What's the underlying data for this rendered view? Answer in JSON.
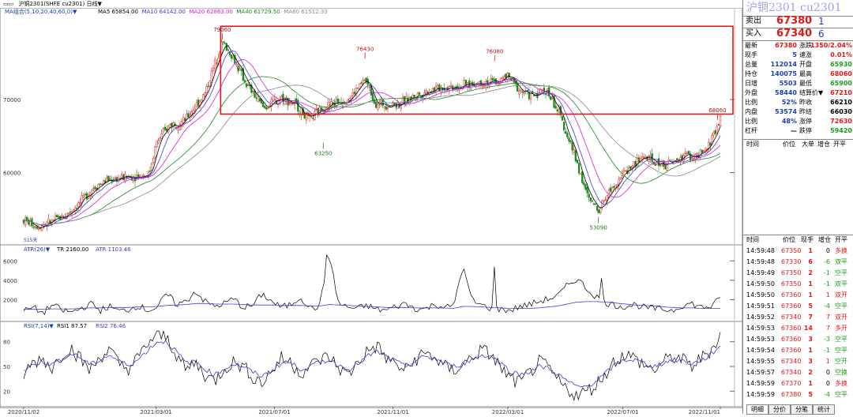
{
  "window": {
    "title": "沪铜2301(SHFE cu2301) 日线▼"
  },
  "main_legend": {
    "indicator": "MA组合(5,10,20,40,60,0)▼",
    "items": [
      {
        "text": "MA5 65854.00",
        "color": "#000000"
      },
      {
        "text": "MA10 64142.00",
        "color": "#3b3bd8"
      },
      {
        "text": "MA20 62863.00",
        "color": "#d81bd8"
      },
      {
        "text": "MA40 61729.50",
        "color": "#1a8a1a"
      },
      {
        "text": "MA60 61512.33",
        "color": "#888888"
      }
    ]
  },
  "atr_legend": {
    "indicator": "ATR(26)▼",
    "items": [
      {
        "text": "TR 2160.00",
        "color": "#000000"
      },
      {
        "text": "ATR 1103.46",
        "color": "#3b3bd8"
      }
    ]
  },
  "rsi_legend": {
    "indicator": "RSI(7,14)▼",
    "items": [
      {
        "text": "RSI1 87.57",
        "color": "#000000"
      },
      {
        "text": "RSI2 76.46",
        "color": "#3b3bd8"
      }
    ]
  },
  "left_marker": "515天",
  "colors": {
    "up": "#e01818",
    "down": "#1a8a1a",
    "box": "#e01818",
    "ma5": "#000000",
    "ma10": "#3b3bd8",
    "ma20": "#d81bd8",
    "ma40": "#1a8a1a",
    "ma60": "#888888",
    "title": "#9f9ff0"
  },
  "chart_data": [
    {
      "type": "candlestick",
      "title": "沪铜2301(SHFE cu2301) 日线",
      "x_tick_labels": [
        "2020/11/02",
        "2021/03/01",
        "2021/07/01",
        "2021/11/01",
        "2022/03/01",
        "2022/07/01",
        "2022/11/01"
      ],
      "x_tick_positions": [
        0,
        0.19,
        0.36,
        0.53,
        0.695,
        0.86,
        1.0
      ],
      "y_tick_labels": [
        "60000",
        "70000"
      ],
      "ylim": [
        51000,
        81000
      ],
      "series_points": [
        [
          0,
          53500
        ],
        [
          0.02,
          52700
        ],
        [
          0.04,
          53300
        ],
        [
          0.06,
          54200
        ],
        [
          0.08,
          55800
        ],
        [
          0.1,
          58000
        ],
        [
          0.12,
          59000
        ],
        [
          0.14,
          59300
        ],
        [
          0.165,
          59600
        ],
        [
          0.18,
          59800
        ],
        [
          0.19,
          64000
        ],
        [
          0.21,
          66600
        ],
        [
          0.23,
          67000
        ],
        [
          0.26,
          70800
        ],
        [
          0.285,
          77900
        ],
        [
          0.3,
          75800
        ],
        [
          0.32,
          72000
        ],
        [
          0.345,
          68800
        ],
        [
          0.37,
          70300
        ],
        [
          0.39,
          69300
        ],
        [
          0.41,
          67100
        ],
        [
          0.43,
          69000
        ],
        [
          0.45,
          69600
        ],
        [
          0.47,
          70400
        ],
        [
          0.49,
          72800
        ],
        [
          0.505,
          69500
        ],
        [
          0.52,
          69300
        ],
        [
          0.54,
          69400
        ],
        [
          0.56,
          70400
        ],
        [
          0.58,
          71200
        ],
        [
          0.6,
          71600
        ],
        [
          0.62,
          71800
        ],
        [
          0.64,
          72000
        ],
        [
          0.66,
          72400
        ],
        [
          0.68,
          72400
        ],
        [
          0.695,
          73200
        ],
        [
          0.71,
          71400
        ],
        [
          0.73,
          70400
        ],
        [
          0.75,
          71400
        ],
        [
          0.77,
          67800
        ],
        [
          0.79,
          62600
        ],
        [
          0.81,
          56500
        ],
        [
          0.825,
          55000
        ],
        [
          0.84,
          57400
        ],
        [
          0.86,
          59900
        ],
        [
          0.875,
          61000
        ],
        [
          0.89,
          62300
        ],
        [
          0.905,
          61300
        ],
        [
          0.92,
          61200
        ],
        [
          0.935,
          61400
        ],
        [
          0.95,
          62600
        ],
        [
          0.965,
          62000
        ],
        [
          0.98,
          63000
        ],
        [
          1.0,
          67380
        ]
      ],
      "price_annotations": [
        {
          "text": "79060",
          "x_frac": 0.285,
          "value": 79060,
          "pos": "above"
        },
        {
          "text": "76430",
          "x_frac": 0.49,
          "value": 76430,
          "pos": "above"
        },
        {
          "text": "76080",
          "x_frac": 0.676,
          "value": 76080,
          "pos": "above"
        },
        {
          "text": "63250",
          "x_frac": 0.43,
          "value": 63250,
          "pos": "below"
        },
        {
          "text": "53090",
          "x_frac": 0.825,
          "value": 53090,
          "pos": "below"
        },
        {
          "text": "68060",
          "x_frac": 0.996,
          "value": 68060,
          "pos": "above"
        }
      ],
      "box": {
        "x_range": [
          0.285,
          1.0
        ],
        "y_range": [
          68000,
          80000
        ]
      }
    },
    {
      "type": "line",
      "title": "ATR(26)",
      "y_tick_labels": [
        "2000",
        "4000",
        "6000"
      ],
      "ylim": [
        0,
        7000
      ],
      "series": [
        {
          "name": "TR",
          "values": [
            800,
            1200,
            600,
            1500,
            900,
            700,
            1100,
            1600,
            900,
            1300,
            800,
            1000,
            1400,
            900,
            1200,
            2600,
            1500,
            1800,
            2900,
            1800,
            1300,
            1600,
            2100,
            1200,
            1400,
            2600,
            1800,
            1200,
            1500,
            2300,
            1100,
            1300,
            6600,
            1600,
            1200,
            1100,
            1400,
            1000,
            900,
            1300,
            1600,
            1100,
            1000,
            1500,
            1300,
            1200,
            5400,
            1900,
            1400,
            1100,
            1000,
            900,
            1300,
            1500,
            1800,
            2100,
            2400,
            3500,
            4200,
            3100,
            2300,
            1700,
            1400,
            1300,
            1500,
            1200,
            1100,
            1000,
            900,
            1400,
            1600,
            1200,
            1300,
            2100
          ]
        },
        {
          "name": "ATR",
          "values": [
            1000,
            1000,
            1000,
            1050,
            1050,
            1050,
            1100,
            1150,
            1150,
            1200,
            1200,
            1200,
            1250,
            1250,
            1300,
            1400,
            1450,
            1500,
            1600,
            1600,
            1550,
            1550,
            1550,
            1500,
            1450,
            1450,
            1450,
            1400,
            1400,
            1400,
            1350,
            1350,
            1500,
            1450,
            1400,
            1350,
            1300,
            1250,
            1200,
            1200,
            1200,
            1150,
            1150,
            1150,
            1150,
            1100,
            1300,
            1300,
            1250,
            1200,
            1150,
            1100,
            1100,
            1100,
            1150,
            1250,
            1350,
            1550,
            1750,
            1800,
            1800,
            1750,
            1650,
            1550,
            1450,
            1400,
            1350,
            1250,
            1200,
            1150,
            1150,
            1100,
            1100,
            1103
          ]
        }
      ]
    },
    {
      "type": "line",
      "title": "RSI(7,14)",
      "y_tick_labels": [
        "20",
        "50",
        "80"
      ],
      "ylim": [
        5,
        95
      ],
      "series": [
        {
          "name": "RSI1",
          "values": [
            40,
            55,
            60,
            48,
            65,
            72,
            58,
            45,
            62,
            70,
            52,
            48,
            60,
            78,
            88,
            85,
            65,
            45,
            55,
            40,
            32,
            48,
            55,
            50,
            38,
            30,
            45,
            60,
            55,
            42,
            50,
            58,
            62,
            48,
            40,
            55,
            68,
            75,
            60,
            52,
            45,
            58,
            66,
            62,
            50,
            45,
            52,
            62,
            70,
            64,
            48,
            35,
            30,
            42,
            55,
            48,
            32,
            22,
            15,
            20,
            28,
            42,
            58,
            65,
            60,
            52,
            45,
            55,
            62,
            58,
            50,
            60,
            70,
            88
          ]
        },
        {
          "name": "RSI2",
          "values": [
            45,
            52,
            56,
            52,
            60,
            66,
            60,
            52,
            58,
            64,
            56,
            52,
            58,
            70,
            80,
            80,
            68,
            54,
            56,
            47,
            40,
            47,
            53,
            50,
            43,
            38,
            45,
            54,
            54,
            47,
            50,
            55,
            58,
            52,
            46,
            53,
            62,
            68,
            62,
            56,
            50,
            56,
            62,
            60,
            54,
            50,
            53,
            58,
            64,
            62,
            54,
            44,
            40,
            44,
            50,
            48,
            40,
            32,
            25,
            26,
            32,
            42,
            52,
            58,
            58,
            54,
            50,
            54,
            58,
            57,
            53,
            57,
            64,
            76
          ]
        }
      ]
    }
  ],
  "panel": {
    "title": "沪铜2301  cu2301",
    "orderbook": [
      {
        "label": "卖出",
        "price": "67380",
        "qty": "1"
      },
      {
        "label": "买入",
        "price": "67340",
        "qty": "6"
      }
    ],
    "quote": [
      {
        "l1": "最新",
        "v1": "67380",
        "c1": "red",
        "l2": "涨跌",
        "v2": "1350/2.04%",
        "c2": "red"
      },
      {
        "l1": "现手",
        "v1": "5",
        "c1": "blue",
        "l2": "速涨",
        "v2": "0.01%",
        "c2": "red"
      },
      {
        "l1": "总量",
        "v1": "112014",
        "c1": "blue",
        "l2": "开盘",
        "v2": "65930",
        "c2": "green"
      },
      {
        "l1": "持仓",
        "v1": "140075",
        "c1": "blue",
        "l2": "最高",
        "v2": "68060",
        "c2": "red"
      },
      {
        "l1": "日增",
        "v1": "5503",
        "c1": "blue",
        "l2": "最低",
        "v2": "65900",
        "c2": "green"
      },
      {
        "l1": "外盘",
        "v1": "58440",
        "c1": "blue",
        "l2": "结算价▼",
        "v2": "67210",
        "c2": "red"
      },
      {
        "l1": "比例",
        "v1": "52%",
        "c1": "blue",
        "l2": "昨收",
        "v2": "66210",
        "c2": "black"
      },
      {
        "l1": "内盘",
        "v1": "53574",
        "c1": "blue",
        "l2": "昨结",
        "v2": "66030",
        "c2": "black"
      },
      {
        "l1": "比例",
        "v1": "48%",
        "c1": "blue",
        "l2": "涨停",
        "v2": "72630",
        "c2": "red"
      },
      {
        "l1": "杠杆",
        "v1": "—",
        "c1": "black",
        "l2": "跌停",
        "v2": "59420",
        "c2": "green"
      }
    ],
    "mid_header": [
      "时间",
      "价位",
      "大单",
      "增仓",
      "开平"
    ],
    "tick_header": [
      "时间",
      "价位",
      "现手",
      "增仓",
      "开平"
    ],
    "ticks": [
      {
        "time": "14:59:48",
        "price": "67350",
        "vol": "1",
        "chg": "0",
        "type": "多换"
      },
      {
        "time": "14:59:48",
        "price": "67330",
        "vol": "6",
        "chg": "-6",
        "type": "双平"
      },
      {
        "time": "14:59:49",
        "price": "67350",
        "vol": "2",
        "chg": "-1",
        "type": "空平"
      },
      {
        "time": "14:59:50",
        "price": "67350",
        "vol": "1",
        "chg": "-1",
        "type": "双平"
      },
      {
        "time": "14:59:50",
        "price": "67360",
        "vol": "1",
        "chg": "1",
        "type": "双开"
      },
      {
        "time": "14:59:51",
        "price": "67360",
        "vol": "5",
        "chg": "-4",
        "type": "空平"
      },
      {
        "time": "14:59:52",
        "price": "67340",
        "vol": "7",
        "chg": "7",
        "type": "双开"
      },
      {
        "time": "14:59:53",
        "price": "67360",
        "vol": "14",
        "chg": "7",
        "type": "多开"
      },
      {
        "time": "14:59:53",
        "price": "67360",
        "vol": "3",
        "chg": "-3",
        "type": "空平"
      },
      {
        "time": "14:59:54",
        "price": "67360",
        "vol": "1",
        "chg": "-1",
        "type": "空平"
      },
      {
        "time": "14:59:55",
        "price": "67340",
        "vol": "3",
        "chg": "1",
        "type": "空开"
      },
      {
        "time": "14:59:57",
        "price": "67340",
        "vol": "2",
        "chg": "0",
        "type": "空换"
      },
      {
        "time": "14:59:59",
        "price": "67370",
        "vol": "1",
        "chg": "0",
        "type": "多换"
      },
      {
        "time": "14:59:59",
        "price": "67380",
        "vol": "5",
        "chg": "-4",
        "type": "空平"
      }
    ],
    "tabs": [
      "明细",
      "分价",
      "分笔",
      "统计"
    ]
  }
}
